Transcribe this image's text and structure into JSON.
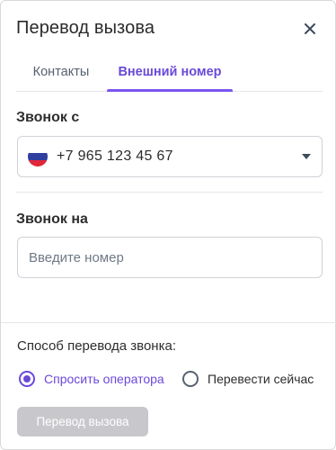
{
  "dialog": {
    "title": "Перевод вызова",
    "close_icon": "close-icon"
  },
  "tabs": [
    {
      "label": "Контакты",
      "active": false
    },
    {
      "label": "Внешний номер",
      "active": true
    }
  ],
  "call_from": {
    "label": "Звонок с",
    "selected_number": "+7 965 123 45 67",
    "flag_icon": "russia-flag-icon",
    "caret_icon": "chevron-down-icon"
  },
  "call_to": {
    "label": "Звонок на",
    "value": "",
    "placeholder": "Введите номер"
  },
  "transfer_method": {
    "label": "Способ перевода звонка:",
    "options": [
      {
        "label": "Спросить оператора",
        "selected": true
      },
      {
        "label": "Перевести сейчас",
        "selected": false
      }
    ]
  },
  "submit": {
    "label": "Перевод вызова",
    "enabled": false
  },
  "colors": {
    "accent": "#6a49d8",
    "disabled_button": "#c8c8cc"
  }
}
